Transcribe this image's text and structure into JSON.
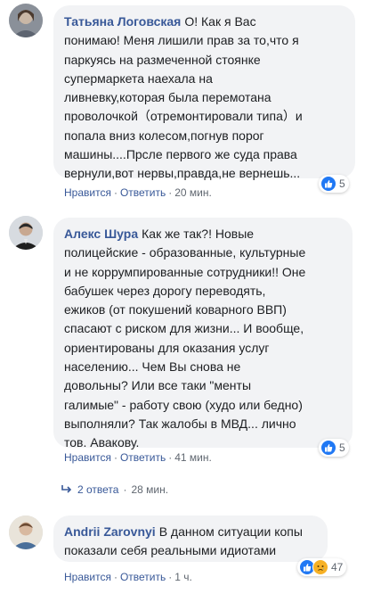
{
  "comments": [
    {
      "author": "Татьяна Логовская",
      "lines": [
        "О!  Как я Вас",
        "понимаю!  Меня лишили прав за то,что я",
        "паркуясь на размеченной стоянке",
        "супермаркета наехала на",
        "ливневку,которая была перемотана",
        "проволочкой（отремонтировали типа）и",
        "попала вниз колесом,погнув порог",
        "машины....Прсле первого же суда права",
        "вернули,вот нервы,правда,не вернешь..."
      ],
      "reaction_count": "5",
      "like_label": "Нравится",
      "reply_label": "Ответить",
      "time": "20 мин."
    },
    {
      "author": "Алекс Шура",
      "lines": [
        "Как же так?! Новые",
        "полицейские - образованные, культурные",
        "и не коррумпированные сотрудники!! Оне",
        "бабушек через дорогу переводять,",
        "ежиков (от покушений коварного ВВП)",
        "спасают с риском для жизни... И вообще,",
        "ориентированы для оказания услуг",
        "населению... Чем Вы снова не",
        "довольны? Или все таки \"менты",
        "галимые\" - работу свою (худо или бедно)",
        "выполняли? Так жалобы в МВД... лично",
        "тов. Авакову."
      ],
      "reaction_count": "5",
      "like_label": "Нравится",
      "reply_label": "Ответить",
      "time": "41 мин.",
      "replies_label": "2 ответа",
      "replies_time": "28 мин."
    },
    {
      "author": "Andrii Zarovnyi",
      "lines": [
        "В данном ситуации копы",
        "показали себя реальными идиотами"
      ],
      "reaction_count": "47",
      "like_label": "Нравится",
      "reply_label": "Ответить",
      "time": "1 ч."
    }
  ],
  "colors": {
    "author": "#385898",
    "bubble_bg": "#f2f3f5",
    "like_blue": "#2078f4",
    "sad_yellow": "#f7b125",
    "meta_gray": "#606770"
  },
  "icons": [
    "like-reaction-icon",
    "sad-reaction-icon",
    "reply-arrow-icon"
  ]
}
